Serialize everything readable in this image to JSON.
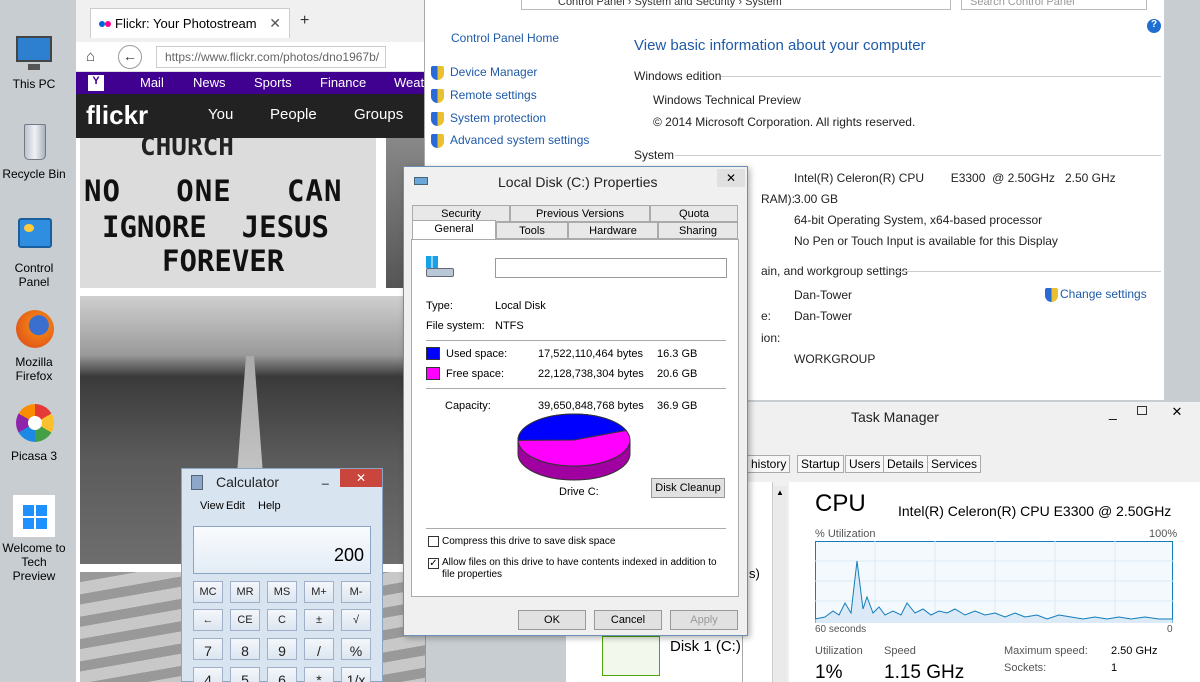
{
  "desktop": {
    "icons": [
      {
        "label": "This PC"
      },
      {
        "label": "Recycle Bin"
      },
      {
        "label": "Control Panel"
      },
      {
        "label": "Mozilla Firefox"
      },
      {
        "label": "Picasa 3"
      },
      {
        "label": "Welcome to Tech Preview"
      }
    ]
  },
  "browser": {
    "tab_title": "Flickr: Your Photostream",
    "url": "https://www.flickr.com/photos/dno1967b/",
    "yahoo_nav": [
      "Mail",
      "News",
      "Sports",
      "Finance",
      "Weat"
    ],
    "flickr_logo": "flickr",
    "flickr_nav": [
      "You",
      "People",
      "Groups"
    ],
    "sign_lines": [
      "CHURCH",
      "NO   ONE   CAN",
      "IGNORE  JESUS",
      "FOREVER"
    ]
  },
  "control_panel": {
    "breadcrumb": [
      "Control Panel",
      "System and Security",
      "System"
    ],
    "search_placeholder": "Search Control Panel",
    "home": "Control Panel Home",
    "side_links": [
      "Device Manager",
      "Remote settings",
      "System protection",
      "Advanced system settings"
    ],
    "page_title": "View basic information about your computer",
    "windows_edition_header": "Windows edition",
    "edition": "Windows Technical Preview",
    "copyright": "© 2014 Microsoft Corporation. All rights reserved.",
    "system_header": "System",
    "processor": "Intel(R) Celeron(R) CPU        E3300  @ 2.50GHz   2.50 GHz",
    "ram_label": "RAM):",
    "ram": "3.00 GB",
    "system_type": "64-bit Operating System, x64-based processor",
    "pen_touch": "No Pen or Touch Input is available for this Display",
    "domain_header": "ain, and workgroup settings",
    "change_settings": "Change settings",
    "computer_name": "Dan-Tower",
    "full_name_label": "e:",
    "full_name": "Dan-Tower",
    "desc_label": "ion:",
    "workgroup": "WORKGROUP"
  },
  "properties": {
    "title": "Local Disk (C:) Properties",
    "tabs_row1": [
      "Security",
      "Previous Versions",
      "Quota"
    ],
    "tabs_row2": [
      "General",
      "Tools",
      "Hardware",
      "Sharing"
    ],
    "type_label": "Type:",
    "type_value": "Local Disk",
    "fs_label": "File system:",
    "fs_value": "NTFS",
    "used_label": "Used space:",
    "used_bytes": "17,522,110,464 bytes",
    "used_gb": "16.3 GB",
    "free_label": "Free space:",
    "free_bytes": "22,128,738,304 bytes",
    "free_gb": "20.6 GB",
    "capacity_label": "Capacity:",
    "capacity_bytes": "39,650,848,768 bytes",
    "capacity_gb": "36.9 GB",
    "drive_label": "Drive C:",
    "cleanup": "Disk Cleanup",
    "compress": "Compress this drive to save disk space",
    "index": "Allow files on this drive to have contents indexed in addition to file properties",
    "ok": "OK",
    "cancel": "Cancel",
    "apply": "Apply",
    "used_fraction": 0.442,
    "used_color": "#0000ff",
    "free_color": "#ff00ff"
  },
  "calculator": {
    "title": "Calculator",
    "menu": [
      "View",
      "Edit",
      "Help"
    ],
    "display": "200",
    "row1": [
      "MC",
      "MR",
      "MS",
      "M+",
      "M-"
    ],
    "row2": [
      "←",
      "CE",
      "C",
      "±",
      "√"
    ],
    "row3": [
      "7",
      "8",
      "9",
      "/",
      "%"
    ],
    "row4": [
      "4",
      "5",
      "6",
      "*",
      "1/x"
    ]
  },
  "task_manager": {
    "title": "Task Manager",
    "tabs": [
      "p history",
      "Startup",
      "Users",
      "Details",
      "Services"
    ],
    "cpu_title": "CPU",
    "cpu_model": "Intel(R) Celeron(R) CPU E3300 @ 2.50GHz",
    "util_label": "% Utilization",
    "max_pct": "100%",
    "seconds": "60 seconds",
    "zero": "0",
    "utilization_label": "Utilization",
    "utilization": "1%",
    "speed_label": "Speed",
    "speed": "1.15 GHz",
    "max_speed_label": "Maximum speed:",
    "max_speed": "2.50 GHz",
    "sockets_label": "Sockets:",
    "sockets": "1",
    "disk_label": "Disk 1 (C:)",
    "partial_s": "s)"
  }
}
